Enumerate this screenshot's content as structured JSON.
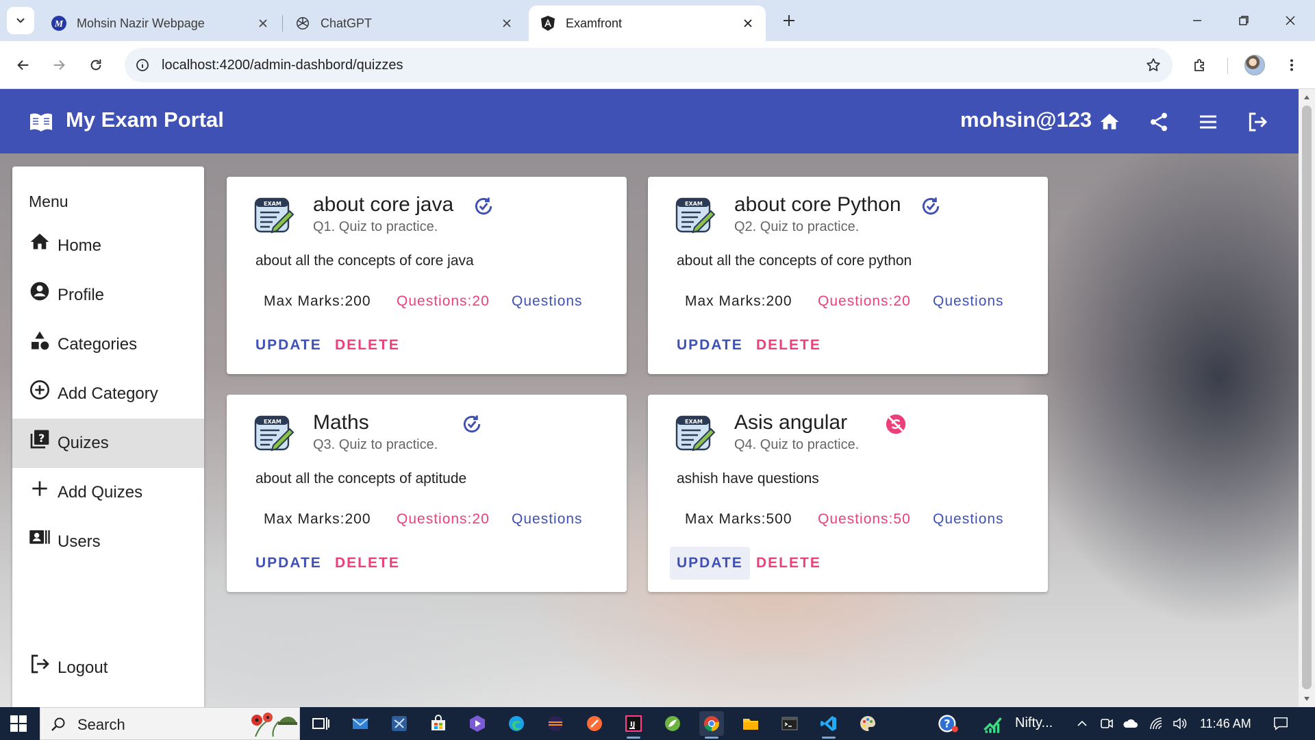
{
  "browser": {
    "tabs": [
      {
        "title": "Mohsin Nazir Webpage",
        "favicon": "m-logo-icon"
      },
      {
        "title": "ChatGPT",
        "favicon": "chatgpt-logo-icon"
      },
      {
        "title": "Examfront",
        "favicon": "angular-logo-icon",
        "active": true
      }
    ],
    "url": "localhost:4200/admin-dashbord/quizzes"
  },
  "header": {
    "title": "My Exam Portal",
    "username": "mohsin@123",
    "color": "#3f51b5"
  },
  "sidebar": {
    "heading": "Menu",
    "items": [
      {
        "label": "Home",
        "icon": "home-icon"
      },
      {
        "label": "Profile",
        "icon": "account-circle-icon"
      },
      {
        "label": "Categories",
        "icon": "category-icon"
      },
      {
        "label": "Add Category",
        "icon": "add-circle-icon"
      },
      {
        "label": "Quizes",
        "icon": "quiz-icon",
        "active": true
      },
      {
        "label": "Add Quizes",
        "icon": "plus-icon"
      },
      {
        "label": "Users",
        "icon": "users-icon"
      }
    ],
    "logout": "Logout"
  },
  "quizzes": [
    {
      "title": "about core java",
      "subtitle": "Q1. Quiz to practice.",
      "description": "about all the concepts of core java",
      "max_marks": "Max Marks:200",
      "questions_count": "Questions:20",
      "questions_link": "Questions",
      "update": "UPDATE",
      "delete": "DELETE",
      "status": "published"
    },
    {
      "title": "about core Python",
      "subtitle": "Q2. Quiz to practice.",
      "description": "about all the concepts of core python",
      "max_marks": "Max Marks:200",
      "questions_count": "Questions:20",
      "questions_link": "Questions",
      "update": "UPDATE",
      "delete": "DELETE",
      "status": "published"
    },
    {
      "title": "Maths",
      "subtitle": "Q3. Quiz to practice.",
      "description": "about all the concepts of aptitude",
      "max_marks": "Max Marks:200",
      "questions_count": "Questions:20",
      "questions_link": "Questions",
      "update": "UPDATE",
      "delete": "DELETE",
      "status": "published"
    },
    {
      "title": "Asis angular",
      "subtitle": "Q4. Quiz to practice.",
      "description": "ashish have questions",
      "max_marks": "Max Marks:500",
      "questions_count": "Questions:50",
      "questions_link": "Questions",
      "update": "UPDATE",
      "delete": "DELETE",
      "status": "unpublished"
    }
  ],
  "taskbar": {
    "search": "Search",
    "stock": "Nifty...",
    "time": "11:46 AM"
  },
  "colors": {
    "primary": "#3f51b5",
    "accent": "#ec407a"
  }
}
